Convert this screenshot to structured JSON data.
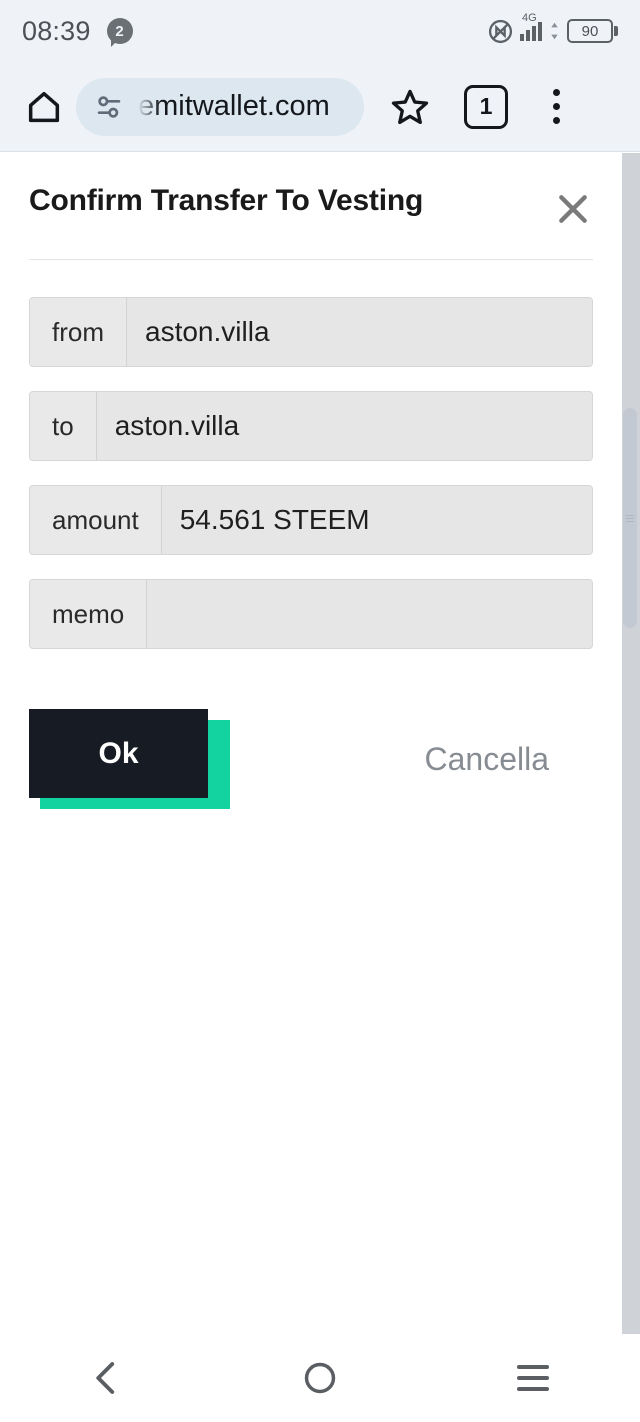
{
  "status_bar": {
    "time": "08:39",
    "notification_count": "2",
    "nfc_icon": "nfc-icon",
    "network_type": "4G",
    "data_arrows_icon": "data-transfer-icon",
    "battery_level": "90"
  },
  "browser": {
    "home_icon": "home-icon",
    "site_settings_icon": "tune-icon",
    "url": "emitwallet.com",
    "bookmark_icon": "star-icon",
    "tab_count": "1",
    "menu_icon": "overflow-menu-icon"
  },
  "modal": {
    "title": "Confirm Transfer To Vesting",
    "close_icon": "close-icon",
    "fields": [
      {
        "label": "from",
        "value": "aston.villa"
      },
      {
        "label": "to",
        "value": "aston.villa"
      },
      {
        "label": "amount",
        "value": "54.561 STEEM"
      },
      {
        "label": "memo",
        "value": ""
      }
    ],
    "confirm_label": "Ok",
    "cancel_label": "Cancella"
  },
  "colors": {
    "accent_teal": "#13d3a0",
    "button_dark": "#171c24",
    "status_bar_bg": "#eff3f8",
    "field_bg": "#e9e9e9"
  },
  "navbar": {
    "back_icon": "back-chevron-icon",
    "home_icon": "home-circle-icon",
    "recents_icon": "recents-icon"
  }
}
